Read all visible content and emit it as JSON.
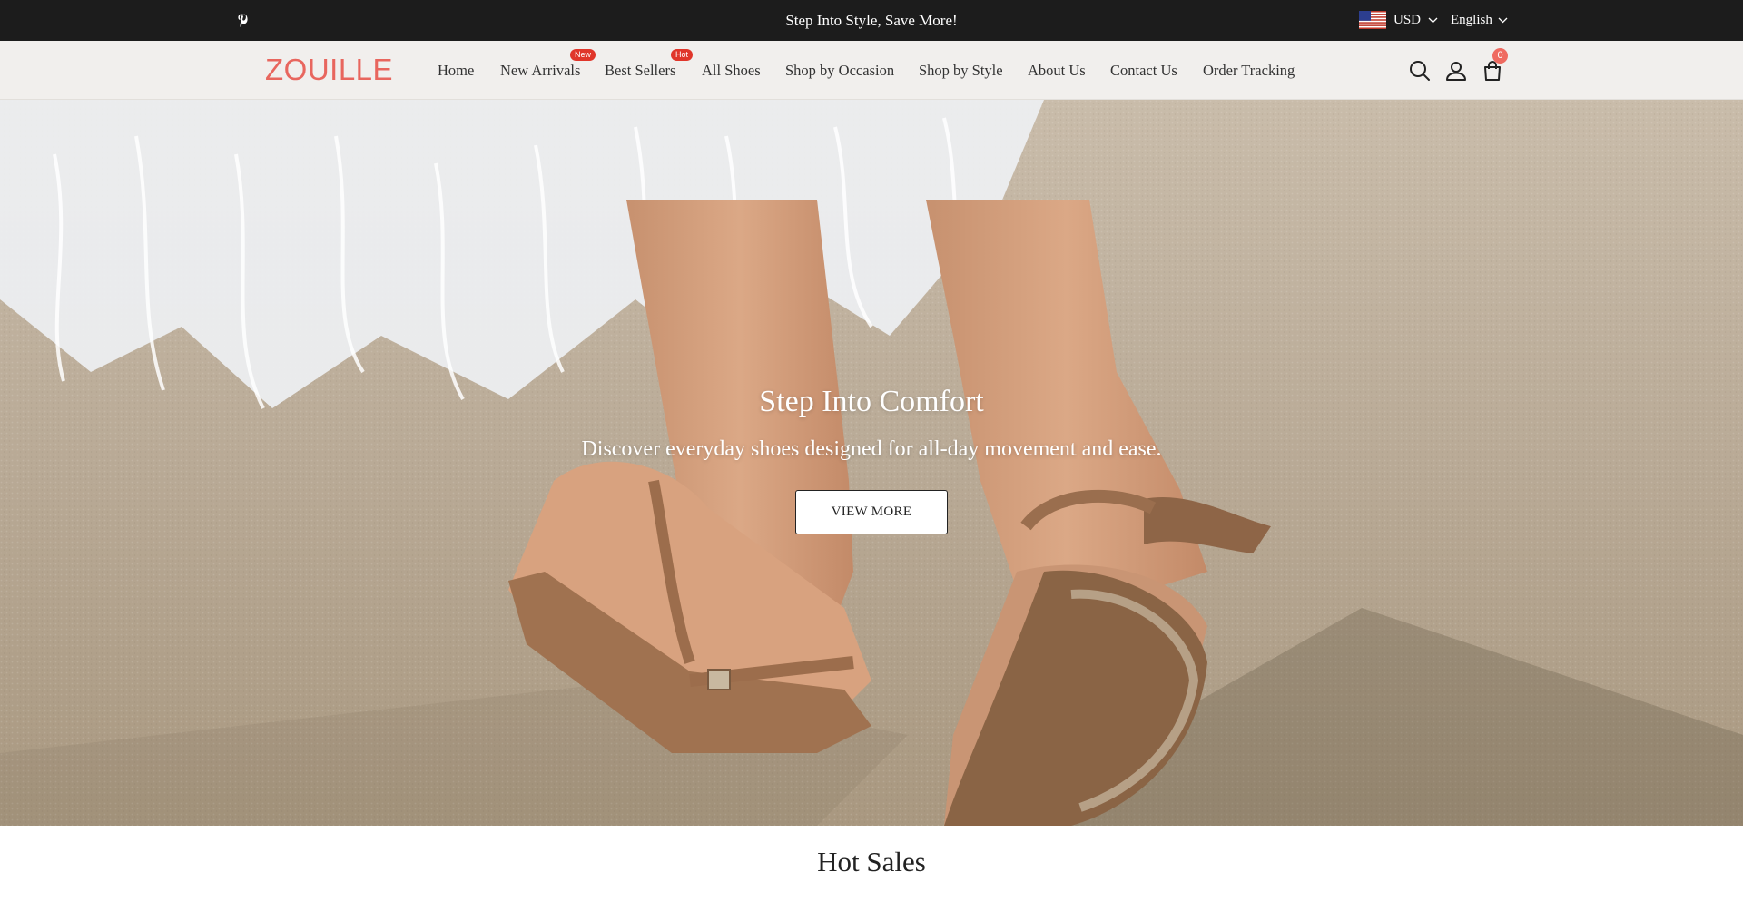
{
  "announcement": {
    "promo_text": "Step Into Style, Save More!",
    "currency": "USD",
    "language": "English",
    "social_icon": "pinterest-icon"
  },
  "header": {
    "logo": "ZOUILLE",
    "nav": [
      {
        "label": "Home"
      },
      {
        "label": "New Arrivals",
        "badge": "New"
      },
      {
        "label": "Best Sellers",
        "badge": "Hot"
      },
      {
        "label": "All Shoes"
      },
      {
        "label": "Shop by Occasion"
      },
      {
        "label": "Shop by Style"
      },
      {
        "label": "About Us"
      },
      {
        "label": "Contact Us"
      },
      {
        "label": "Order Tracking"
      }
    ],
    "icons": [
      "search-icon",
      "account-icon",
      "cart-icon"
    ],
    "cart_count": "0"
  },
  "hero": {
    "title": "Step Into Comfort",
    "subtitle": "Discover everyday shoes designed for all-day movement and ease.",
    "button_label": "VIEW MORE"
  },
  "sections": {
    "hot_sales_title": "Hot Sales"
  },
  "colors": {
    "announcement_bg": "#1c1c1c",
    "header_bg": "#f1efed",
    "logo": "#e8665e",
    "badge": "#e0362a",
    "cart_badge": "#ef6a60"
  }
}
